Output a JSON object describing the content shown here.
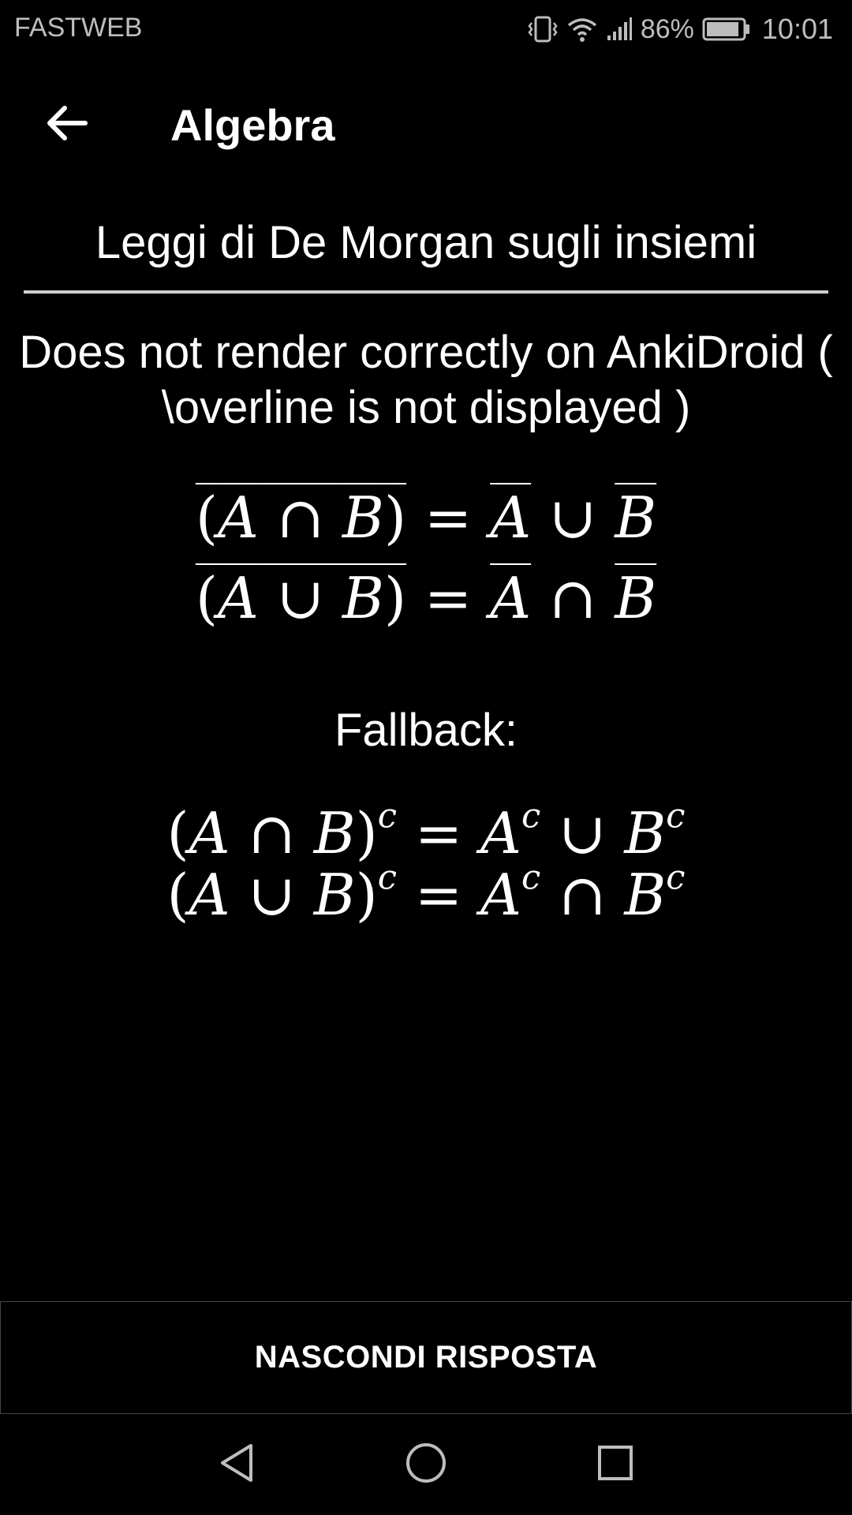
{
  "status_bar": {
    "carrier": "FASTWEB",
    "battery_percent": "86%",
    "time": "10:01",
    "icons": [
      "vibrate-icon",
      "wifi-icon",
      "signal-icon",
      "battery-icon"
    ]
  },
  "app_bar": {
    "back_icon": "arrow-left-icon",
    "title": "Algebra"
  },
  "card": {
    "question": "Leggi di De Morgan sugli insiemi",
    "note": "Does not render correctly on AnkiDroid ( \\overline is not displayed )",
    "overline_formulas": [
      {
        "lhs": "(A ∩ B)",
        "rhs": [
          "A",
          "∪",
          "B"
        ]
      },
      {
        "lhs": "(A ∪ B)",
        "rhs": [
          "A",
          "∩",
          "B"
        ]
      }
    ],
    "fallback_label": "Fallback:",
    "fallback_formulas": [
      {
        "text": "(A ∩ B)^c = A^c ∪ B^c"
      },
      {
        "text": "(A ∪ B)^c = A^c ∩ B^c"
      }
    ]
  },
  "answer_button": {
    "label": "NASCONDI RISPOSTA"
  },
  "nav_bar": {
    "icons": [
      "nav-back-icon",
      "nav-home-icon",
      "nav-recents-icon"
    ]
  }
}
